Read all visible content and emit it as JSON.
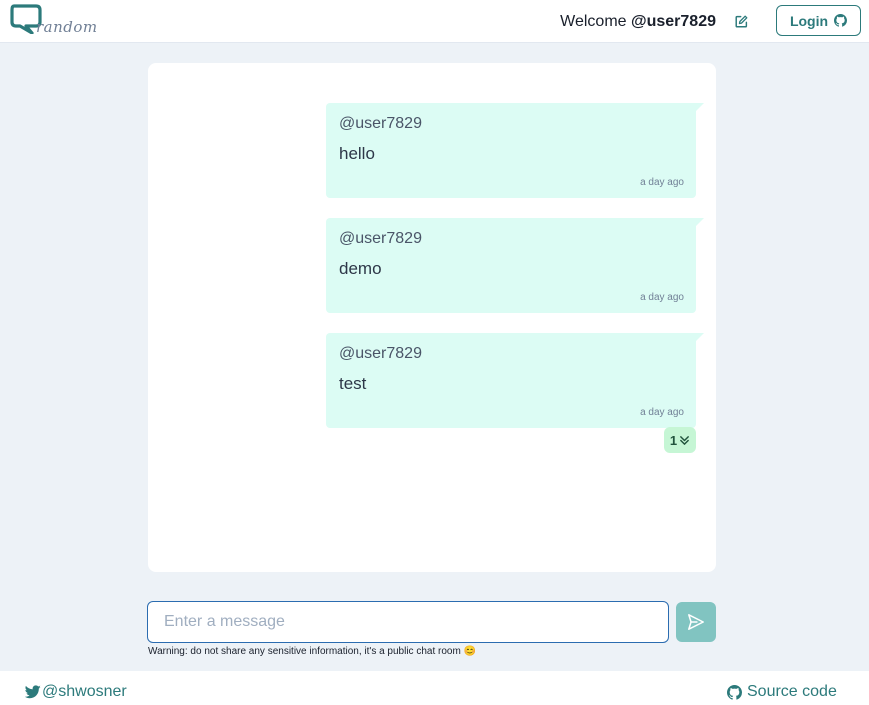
{
  "header": {
    "logo_text": "random",
    "welcome_prefix": "Welcome",
    "username": "@user7829",
    "login_label": "Login"
  },
  "messages": [
    {
      "user": "@user7829",
      "text": "hello",
      "time": "a day ago"
    },
    {
      "user": "@user7829",
      "text": "demo",
      "time": "a day ago"
    },
    {
      "user": "@user7829",
      "text": "test",
      "time": "a day ago"
    }
  ],
  "reaction": {
    "count": "1"
  },
  "composer": {
    "placeholder": "Enter a message",
    "warning": "Warning: do not share any sensitive information, it's a public chat room 😊"
  },
  "footer": {
    "twitter_handle": "@shwosner",
    "source_label": "Source code"
  },
  "colors": {
    "accent": "#2c7a7b",
    "message_bg": "#dcfcf4",
    "page_bg": "#edf2f7",
    "send_button": "#81c4c1"
  }
}
